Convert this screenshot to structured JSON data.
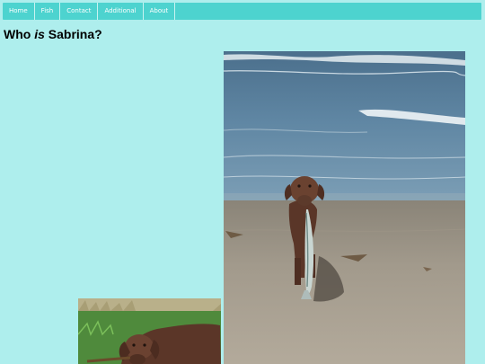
{
  "nav": {
    "items": [
      {
        "label": "Home"
      },
      {
        "label": "Fish"
      },
      {
        "label": "Contact"
      },
      {
        "label": "Additional"
      },
      {
        "label": "About"
      }
    ]
  },
  "page": {
    "title_before": "Who ",
    "title_emph": "is",
    "title_after": " Sabrina?"
  },
  "colors": {
    "background": "#aeeeed",
    "navbar": "#4dd3cf",
    "nav_text": "#ffffff"
  },
  "images": {
    "beach_photo": {
      "subject": "brown dog carrying a fish on a beach"
    },
    "grass_photo": {
      "subject": "brown dog lying in grass"
    }
  }
}
